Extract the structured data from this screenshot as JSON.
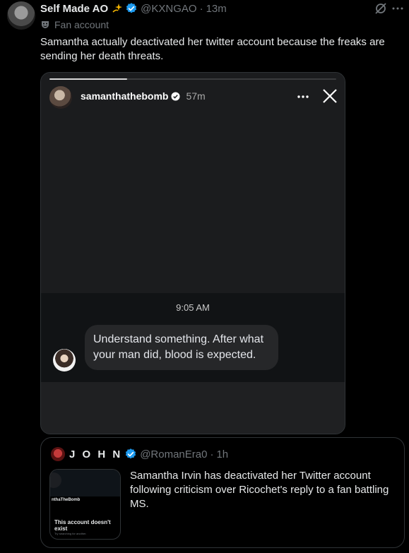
{
  "post": {
    "author_name": "Self Made AO",
    "author_emoji": "sparkle-star",
    "author_handle": "@KXNGAO",
    "time": "13m",
    "label": "Fan account",
    "text": "Samantha actually deactivated her twitter account because the freaks are sending her death threats."
  },
  "story": {
    "progress": 0.27,
    "username": "samanthathebomb",
    "time": "57m",
    "message_time": "9:05 AM",
    "message": "Understand something. After what your man did, blood is expected."
  },
  "quote": {
    "author_name": "J O H N",
    "author_handle": "@RomanEra0",
    "time": "1h",
    "text": "Samantha Irvin has deactivated her Twitter account following criticism over Ricochet's reply to a fan battling MS.",
    "thumb_name": "nthaTheBomb",
    "thumb_message": "This account doesn't exist",
    "thumb_sub": "Try searching for another."
  },
  "colors": {
    "background": "#000000",
    "verified": "#1d9bf0",
    "muted": "#71767b",
    "text": "#e7e9ea"
  }
}
